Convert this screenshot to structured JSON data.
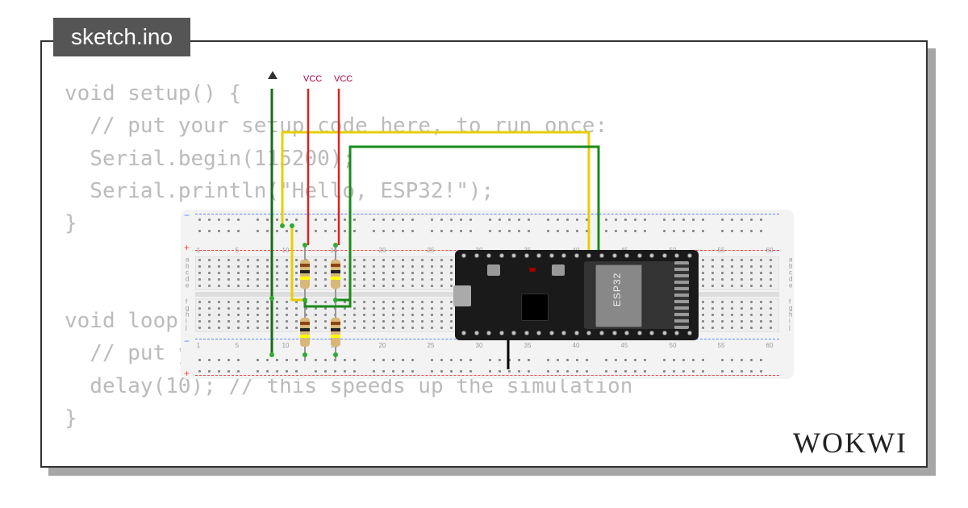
{
  "tab": {
    "title": "sketch.ino"
  },
  "logo": "WOKWI",
  "code": {
    "text": "void setup() {\n  // put your setup code here, to run once:\n  Serial.begin(115200);\n  Serial.println(\"Hello, ESP32!\");\n}\n\n\nvoid loop() {\n  // put your ma\n  delay(10); // this speeds up the simulation\n}"
  },
  "labels": {
    "vcc": "VCC",
    "esp_module": "ESP32"
  },
  "breadboard": {
    "cols": 60,
    "row_letters_top": [
      "a",
      "b",
      "c",
      "d",
      "e"
    ],
    "row_letters_bot": [
      "f",
      "g",
      "h",
      "i",
      "j"
    ],
    "num_marks": [
      "1",
      "5",
      "10",
      "15",
      "20",
      "25",
      "30",
      "35",
      "40",
      "45",
      "50",
      "55",
      "60"
    ]
  },
  "components": {
    "board": "ESP32 DevKit",
    "resistors": 4,
    "wires": [
      "green",
      "green",
      "yellow",
      "yellow",
      "red",
      "red",
      "black"
    ]
  }
}
